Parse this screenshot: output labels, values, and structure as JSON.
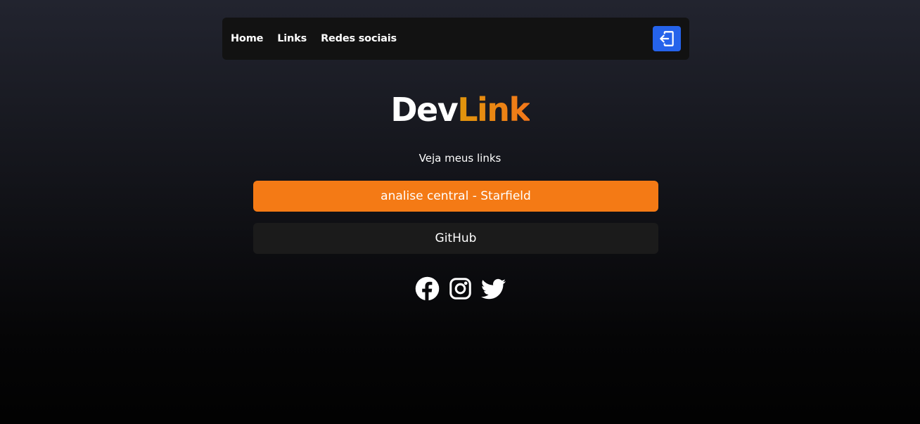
{
  "nav": {
    "items": [
      {
        "label": "Home"
      },
      {
        "label": "Links"
      },
      {
        "label": "Redes sociais"
      }
    ],
    "logout_icon": "logout-icon"
  },
  "logo": {
    "part1": "Dev",
    "part2": "Link"
  },
  "subtitle": "Veja meus links",
  "links": [
    {
      "label": "analise central - Starfield",
      "bg": "#f47a15"
    },
    {
      "label": "GitHub",
      "bg": "#1b1b1b"
    }
  ],
  "social": [
    {
      "icon": "facebook-icon"
    },
    {
      "icon": "instagram-icon"
    },
    {
      "icon": "twitter-icon"
    }
  ],
  "colors": {
    "accent_blue": "#2563eb",
    "accent_orange": "#f47a15",
    "logo_gradient_start": "#e0960c",
    "logo_gradient_end": "#f3771a"
  }
}
